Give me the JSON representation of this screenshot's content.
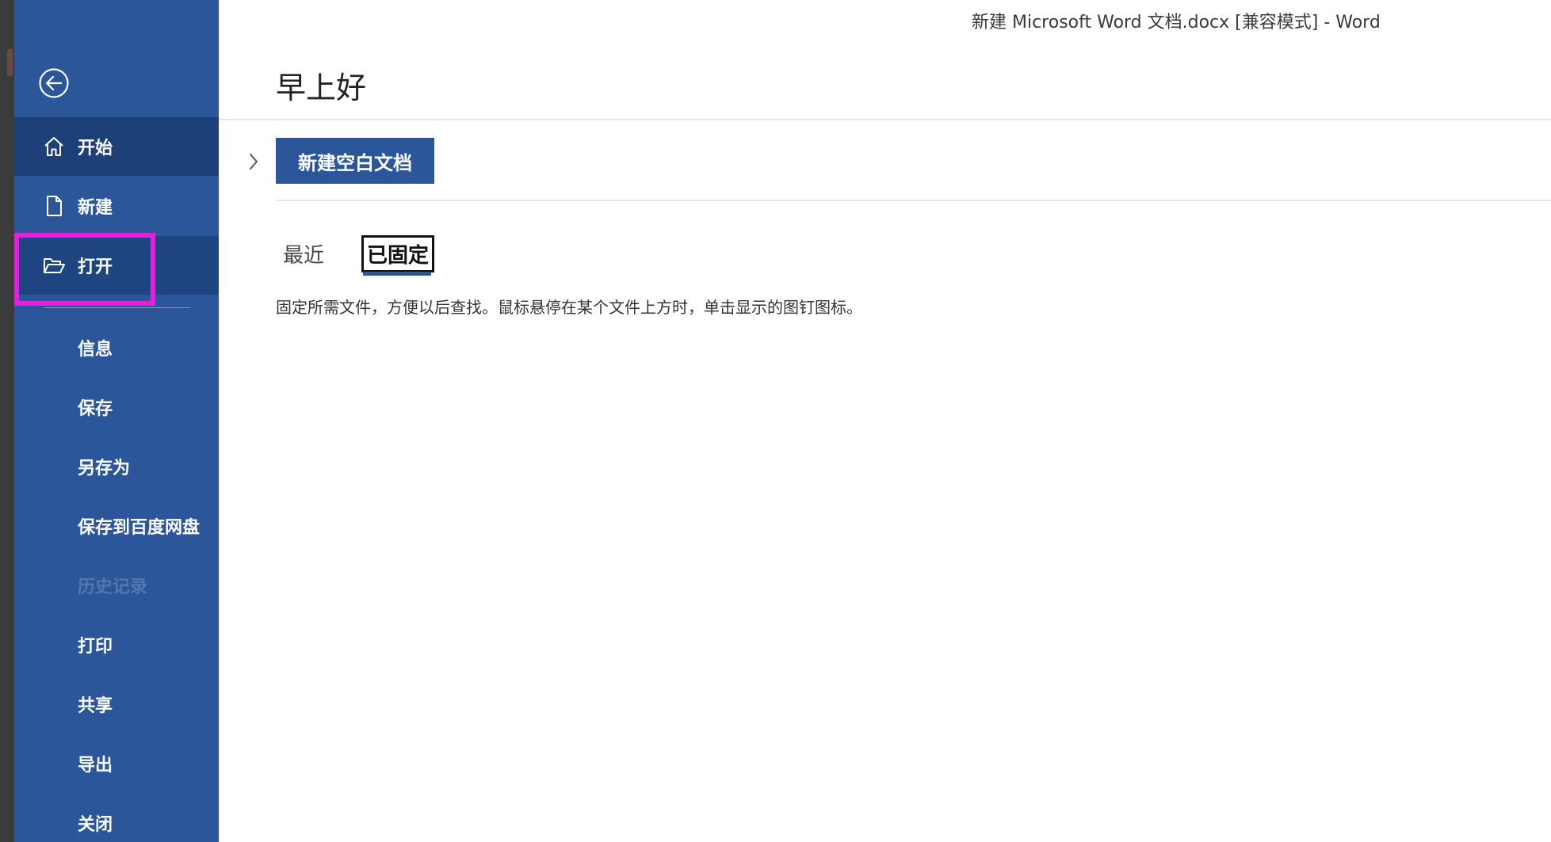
{
  "window": {
    "title": "新建 Microsoft Word 文档.docx [兼容模式]  -  Word"
  },
  "sidebar": {
    "back_icon": "back-arrow-circle-icon",
    "items": [
      {
        "label": "开始",
        "icon": "home-icon",
        "state": "active"
      },
      {
        "label": "新建",
        "icon": "new-document-icon",
        "state": "normal"
      },
      {
        "label": "打开",
        "icon": "open-folder-icon",
        "state": "highlighted"
      },
      {
        "label": "信息",
        "state": "normal"
      },
      {
        "label": "保存",
        "state": "normal"
      },
      {
        "label": "另存为",
        "state": "normal"
      },
      {
        "label": "保存到百度网盘",
        "state": "normal"
      },
      {
        "label": "历史记录",
        "state": "disabled"
      },
      {
        "label": "打印",
        "state": "normal"
      },
      {
        "label": "共享",
        "state": "normal"
      },
      {
        "label": "导出",
        "state": "normal"
      },
      {
        "label": "关闭",
        "state": "normal"
      }
    ]
  },
  "main": {
    "greeting": "早上好",
    "new_blank_doc_label": "新建空白文档",
    "tabs": [
      {
        "label": "最近",
        "selected": false
      },
      {
        "label": "已固定",
        "selected": true
      }
    ],
    "pinned_hint": "固定所需文件，方便以后查找。鼠标悬停在某个文件上方时，单击显示的图钉图标。"
  },
  "colors": {
    "sidebar": "#2b579a",
    "sidebar_active": "#1e4078",
    "highlight": "#e61fdc"
  }
}
